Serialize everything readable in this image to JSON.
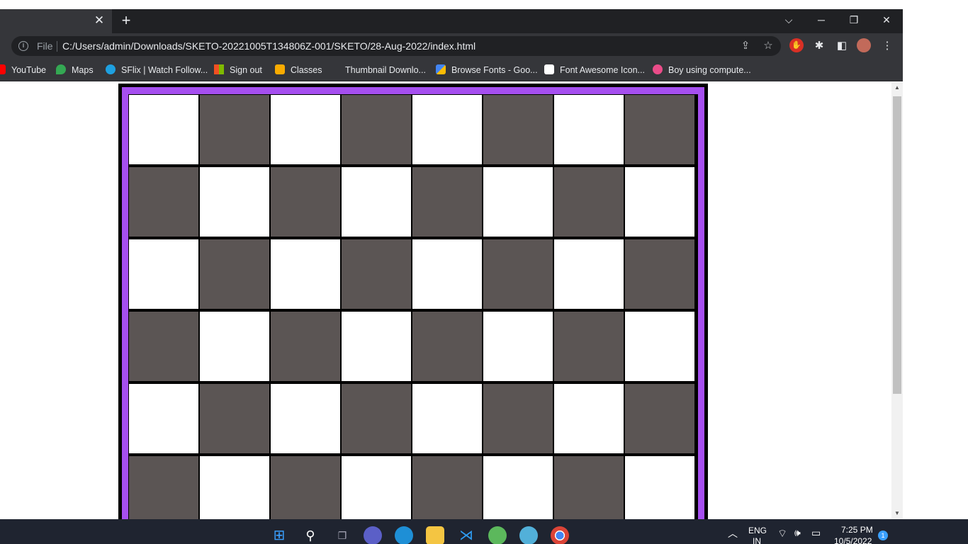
{
  "browser": {
    "tab": {
      "close_glyph": "✕"
    },
    "new_tab_glyph": "+",
    "window_controls": {
      "tab_search": "⌵",
      "minimize": "─",
      "restore": "❐",
      "close": "✕"
    },
    "omnibox": {
      "scheme_label": "File",
      "url": "C:/Users/admin/Downloads/SKETO-20221005T134806Z-001/SKETO/28-Aug-2022/index.html"
    },
    "bookmarks": [
      {
        "label": "YouTube",
        "icon": "youtube-icon",
        "color": "#ff0000"
      },
      {
        "label": "Maps",
        "icon": "maps-icon",
        "color": "#34a853"
      },
      {
        "label": "SFlix | Watch Follow...",
        "icon": "sflix-icon",
        "color": "#1ea0e0"
      },
      {
        "label": "Sign out",
        "icon": "microsoft-icon",
        "color": "#f25022"
      },
      {
        "label": "Classes",
        "icon": "classroom-icon",
        "color": "#f9ab00"
      },
      {
        "label": "Thumbnail Downlo...",
        "icon": "page-icon",
        "color": "#35363a"
      },
      {
        "label": "Browse Fonts - Goo...",
        "icon": "google-fonts-icon",
        "color": "#4285f4"
      },
      {
        "label": "Font Awesome Icon...",
        "icon": "font-awesome-icon",
        "color": "#ffffff"
      },
      {
        "label": "Boy using compute...",
        "icon": "dribbble-icon",
        "color": "#ea4c89"
      }
    ]
  },
  "page": {
    "board": {
      "rows_visible": 6,
      "columns": 8,
      "first_square": "light",
      "colors": {
        "light": "#ffffff",
        "dark": "#5b5554",
        "frame": "#a64ff0",
        "border": "#000000"
      }
    }
  },
  "taskbar": {
    "apps": [
      "windows-start-icon",
      "search-icon",
      "task-view-icon",
      "teams-chat-icon",
      "edge-icon",
      "file-explorer-icon",
      "vscode-icon",
      "utorrent-icon",
      "paint-icon",
      "chrome-icon"
    ],
    "language": "ENG",
    "region": "IN",
    "time": "7:25 PM",
    "date": "10/5/2022",
    "notification_count": "1"
  }
}
